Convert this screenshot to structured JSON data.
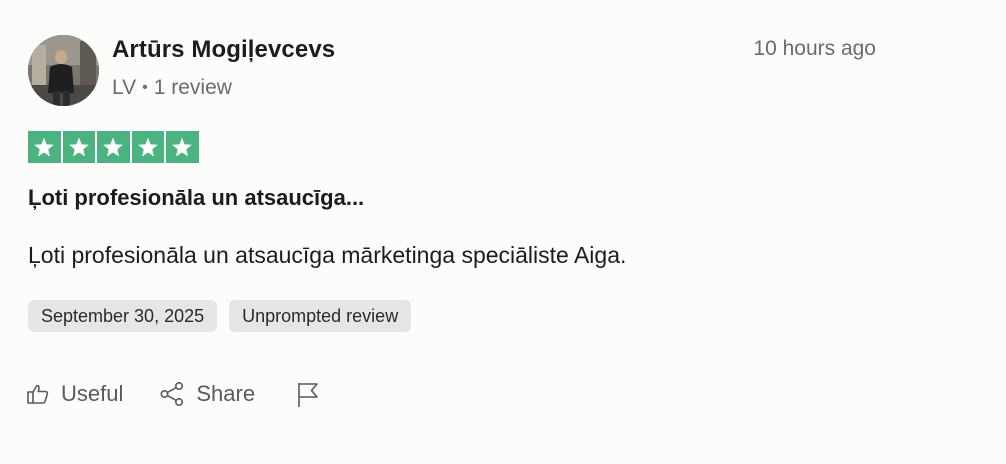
{
  "reviewer": {
    "name": "Artūrs Mogiļevcevs",
    "country": "LV",
    "separator": "•",
    "reviews_count": "1 review"
  },
  "timestamp": "10 hours ago",
  "rating": {
    "stars": 5,
    "max": 5,
    "color": "#4bb37f"
  },
  "review": {
    "title": "Ļoti profesionāla un atsaucīga...",
    "text": "Ļoti profesionāla un atsaucīga mārketinga speciāliste Aiga."
  },
  "tags": {
    "date": "September 30, 2025",
    "type": "Unprompted review"
  },
  "actions": {
    "useful_label": "Useful",
    "share_label": "Share"
  },
  "icons": {
    "useful": "thumbs-up-icon",
    "share": "share-icon",
    "report": "flag-icon"
  }
}
